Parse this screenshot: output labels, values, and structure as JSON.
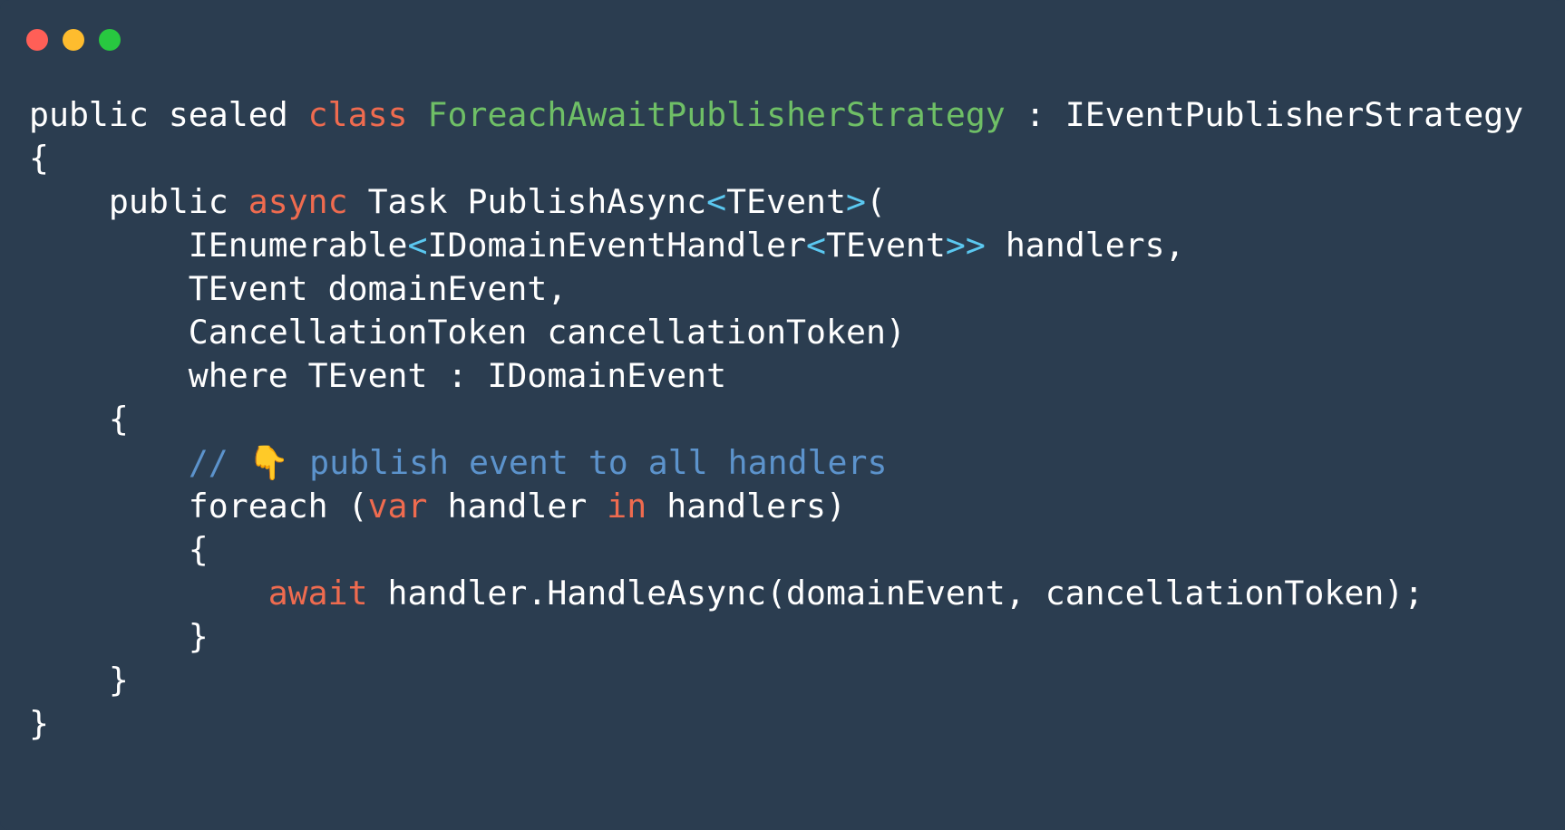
{
  "window": {
    "controls": [
      {
        "name": "close",
        "color": "#ff5f57"
      },
      {
        "name": "minimize",
        "color": "#febc2e"
      },
      {
        "name": "maximize",
        "color": "#28c840"
      }
    ]
  },
  "colors": {
    "background": "#2b3d50",
    "text": "#ffffff",
    "keyword": "#ef6b4f",
    "type": "#6fbf66",
    "punctuation": "#5bc8f0",
    "comment": "#5c93cc"
  },
  "code": {
    "lines": [
      [
        {
          "t": "public sealed "
        },
        {
          "t": "class",
          "c": "keyword"
        },
        {
          "t": " "
        },
        {
          "t": "ForeachAwaitPublisherStrategy",
          "c": "type"
        },
        {
          "t": " : IEventPublisherStrategy"
        }
      ],
      [
        {
          "t": "{"
        }
      ],
      [
        {
          "t": "    public "
        },
        {
          "t": "async",
          "c": "keyword"
        },
        {
          "t": " Task PublishAsync"
        },
        {
          "t": "<",
          "c": "punct"
        },
        {
          "t": "TEvent"
        },
        {
          "t": ">",
          "c": "punct"
        },
        {
          "t": "("
        }
      ],
      [
        {
          "t": "        IEnumerable"
        },
        {
          "t": "<",
          "c": "punct"
        },
        {
          "t": "IDomainEventHandler"
        },
        {
          "t": "<",
          "c": "punct"
        },
        {
          "t": "TEvent"
        },
        {
          "t": ">>",
          "c": "punct"
        },
        {
          "t": " handlers,"
        }
      ],
      [
        {
          "t": "        TEvent domainEvent,"
        }
      ],
      [
        {
          "t": "        CancellationToken cancellationToken)"
        }
      ],
      [
        {
          "t": "        where TEvent : IDomainEvent"
        }
      ],
      [
        {
          "t": "    {"
        }
      ],
      [
        {
          "t": "        "
        },
        {
          "t": "// ",
          "c": "comment"
        },
        {
          "t": "👇",
          "c": "emoji"
        },
        {
          "t": " publish event to all handlers",
          "c": "comment"
        }
      ],
      [
        {
          "t": "        foreach ("
        },
        {
          "t": "var",
          "c": "keyword"
        },
        {
          "t": " handler "
        },
        {
          "t": "in",
          "c": "keyword"
        },
        {
          "t": " handlers)"
        }
      ],
      [
        {
          "t": "        {"
        }
      ],
      [
        {
          "t": "            "
        },
        {
          "t": "await",
          "c": "keyword"
        },
        {
          "t": " handler.HandleAsync(domainEvent, cancellationToken);"
        }
      ],
      [
        {
          "t": "        }"
        }
      ],
      [
        {
          "t": "    }"
        }
      ],
      [
        {
          "t": "}"
        }
      ]
    ]
  }
}
